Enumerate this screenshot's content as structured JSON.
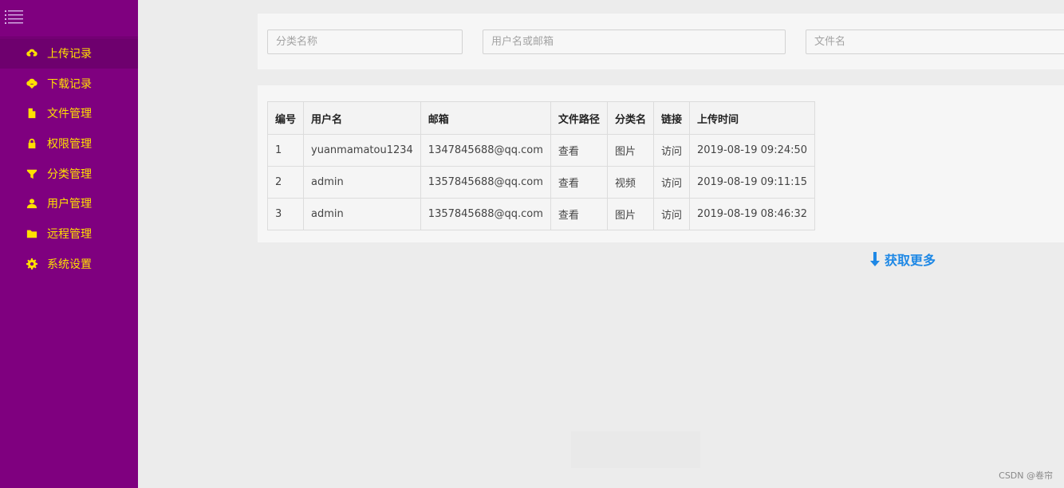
{
  "sidebar": {
    "items": [
      {
        "label": "上传记录",
        "icon": "cloud-upload-icon",
        "active": true
      },
      {
        "label": "下载记录",
        "icon": "cloud-download-icon",
        "active": false
      },
      {
        "label": "文件管理",
        "icon": "file-icon",
        "active": false
      },
      {
        "label": "权限管理",
        "icon": "lock-icon",
        "active": false
      },
      {
        "label": "分类管理",
        "icon": "filter-icon",
        "active": false
      },
      {
        "label": "用户管理",
        "icon": "user-icon",
        "active": false
      },
      {
        "label": "远程管理",
        "icon": "folder-icon",
        "active": false
      },
      {
        "label": "系统设置",
        "icon": "gear-icon",
        "active": false
      }
    ]
  },
  "search": {
    "category_placeholder": "分类名称",
    "user_placeholder": "用户名或邮箱",
    "file_placeholder": "文件名"
  },
  "table": {
    "headers": [
      "编号",
      "用户名",
      "邮箱",
      "文件路径",
      "分类名",
      "链接",
      "上传时间"
    ],
    "rows": [
      {
        "id": "1",
        "username": "yuanmamatou1234",
        "email": "1347845688@qq.com",
        "path": "查看",
        "category": "图片",
        "link": "访问",
        "time": "2019-08-19 09:24:50"
      },
      {
        "id": "2",
        "username": "admin",
        "email": "1357845688@qq.com",
        "path": "查看",
        "category": "视频",
        "link": "访问",
        "time": "2019-08-19 09:11:15"
      },
      {
        "id": "3",
        "username": "admin",
        "email": "1357845688@qq.com",
        "path": "查看",
        "category": "图片",
        "link": "访问",
        "time": "2019-08-19 08:46:32"
      }
    ]
  },
  "load_more": "获取更多",
  "watermark": "CSDN @卷帘",
  "colors": {
    "sidebar": "#7f007f",
    "nav_text": "#ffe000",
    "link": "#1e88e5"
  }
}
